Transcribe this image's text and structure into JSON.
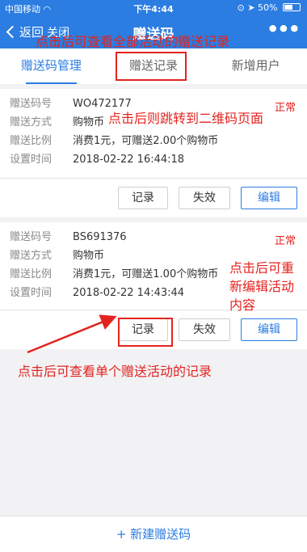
{
  "status_bar": {
    "carrier": "中国移动",
    "wifi_icon": "wifi-icon",
    "time": "下午4:44",
    "battery": "50%"
  },
  "nav": {
    "back": "返回",
    "close": "关闭",
    "title": "赠送码",
    "more": "•••"
  },
  "tabs": [
    {
      "label": "赠送码管理"
    },
    {
      "label": "赠送记录"
    },
    {
      "label": "新增用户"
    }
  ],
  "labels": {
    "code": "赠送码号",
    "method": "赠送方式",
    "ratio": "赠送比例",
    "time": "设置时间"
  },
  "cards": [
    {
      "code": "WO472177",
      "method": "购物币",
      "ratio": "消费1元，可赠送2.00个购物币",
      "time": "2018-02-22 16:44:18",
      "status": "正常"
    },
    {
      "code": "BS691376",
      "method": "购物币",
      "ratio": "消费1元，可赠送1.00个购物币",
      "time": "2018-02-22 14:43:44",
      "status": "正常"
    }
  ],
  "buttons": {
    "record": "记录",
    "invalidate": "失效",
    "edit": "编辑"
  },
  "bottom": {
    "new_code": "+ 新建赠送码"
  },
  "annotations": {
    "all_records": "点击后可查看全部活动的赠送记录",
    "qr": "点击后则跳转到二维码页面",
    "edit": "点击后可重新编辑活动内容",
    "single": "点击后可查看单个赠送活动的记录"
  },
  "colors": {
    "primary": "#2b7de1",
    "danger": "#e3231f"
  }
}
